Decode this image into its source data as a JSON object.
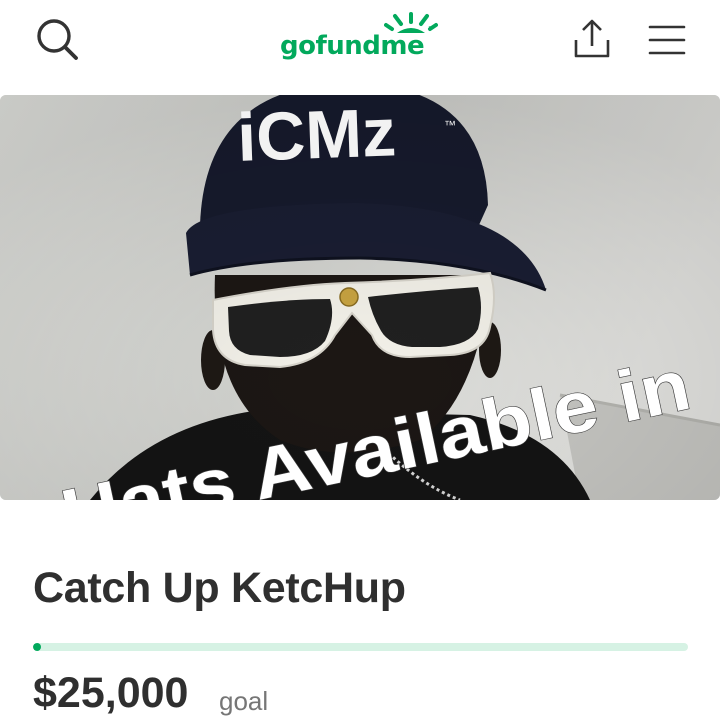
{
  "header": {
    "logo_text": "gofundme",
    "logo_tm": "™",
    "search_icon": "search-icon",
    "share_icon": "share-icon",
    "menu_icon": "hamburger-menu-icon"
  },
  "hero": {
    "hat_logo_text": "iCMz",
    "hat_logo_tm": "™",
    "overlay_caption": "Hats Available in"
  },
  "campaign": {
    "title": "Catch Up KetcHup",
    "goal_amount": "$25,000",
    "goal_label": "goal",
    "progress_fraction": 0.01
  },
  "colors": {
    "brand_green": "#02a95c",
    "progress_track": "#d6f2e4",
    "title_text": "#2f2f2f",
    "muted_text": "#767676",
    "icon_dark": "#333333"
  }
}
